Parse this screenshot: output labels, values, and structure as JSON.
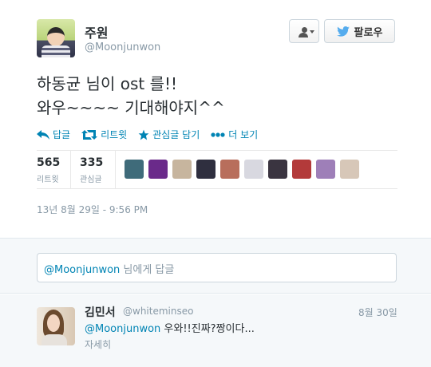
{
  "author": {
    "name": "주원",
    "handle": "@Moonjunwon"
  },
  "buttons": {
    "follow_label": "팔로우"
  },
  "tweet": {
    "line1": "하동균 님이 ost 를!!",
    "line2": "와우~~~~ 기대해야지^^"
  },
  "actions": {
    "reply": "답글",
    "retweet": "리트윗",
    "favorite": "관심글 담기",
    "more": "더 보기"
  },
  "stats": {
    "retweets": "565",
    "retweets_label": "리트윗",
    "favorites": "335",
    "favorites_label": "관심글"
  },
  "date": "13년 8월 29일 - 9:56 PM",
  "reply_box": {
    "mention": "@Moonjunwon",
    "placeholder": " 님에게 답글"
  },
  "reply": {
    "name": "김민서",
    "handle": "@whiteminseo",
    "date": "8월 30일",
    "mention": "@Moonjunwon",
    "text": " 우와!!진짜?짱이다...",
    "more": "자세히"
  },
  "favoriters_colors": [
    "#3f6b7a",
    "#6a2a8a",
    "#c7b59e",
    "#2f2f3f",
    "#b86e5c",
    "#d8d8e0",
    "#3a3440",
    "#b33a3a",
    "#9e7fb8",
    "#d7c7b8"
  ],
  "colors": {
    "link": "#0084b4",
    "twitter_blue": "#55acee",
    "muted": "#8899a6"
  }
}
